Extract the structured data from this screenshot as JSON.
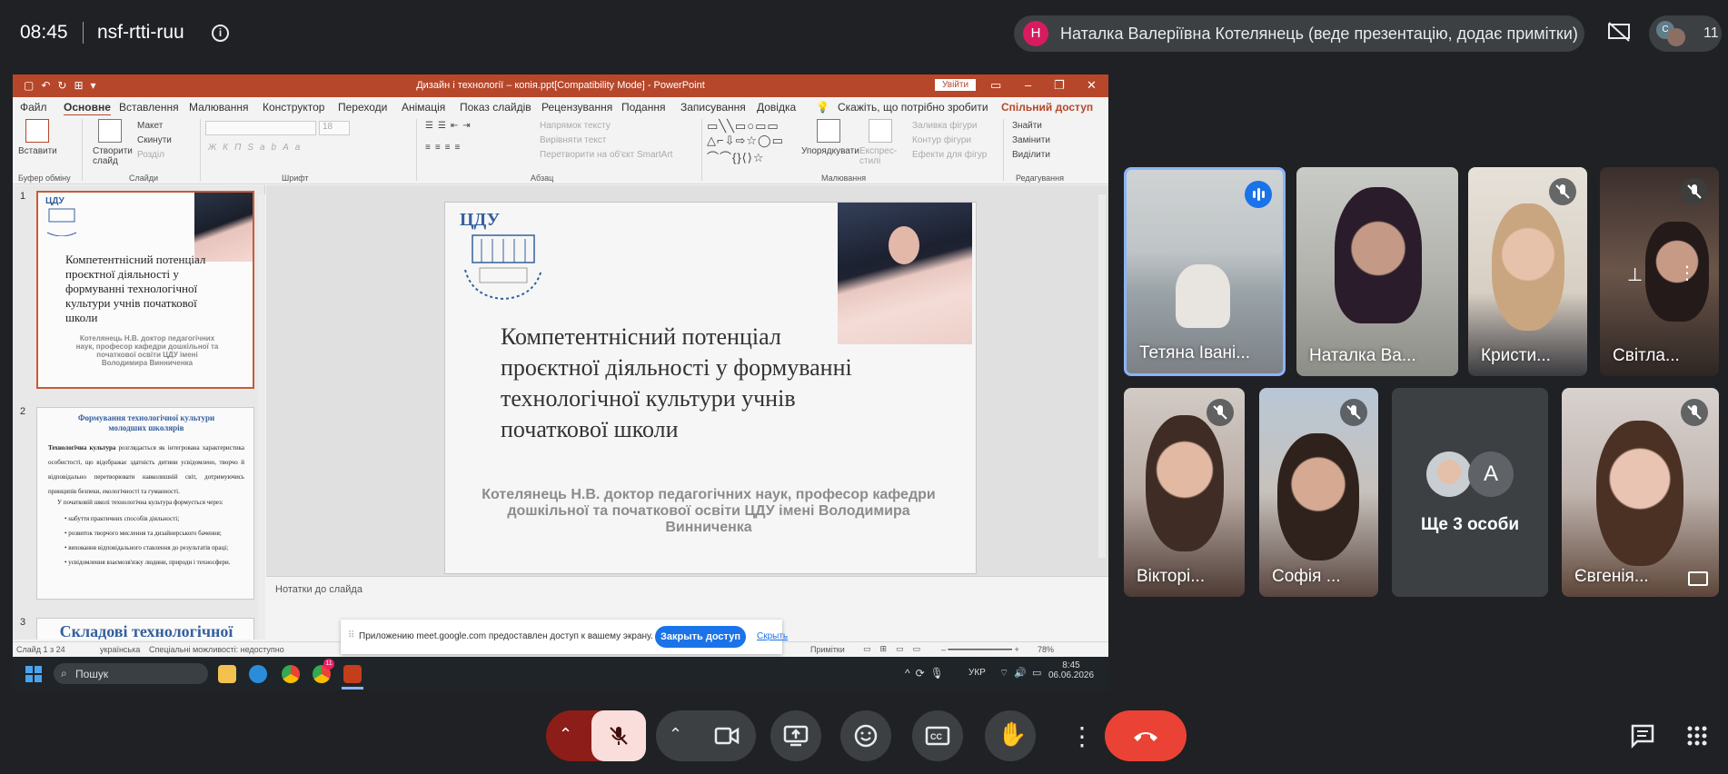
{
  "topbar": {
    "time": "08:45",
    "meeting_code": "nsf-rtti-ruu",
    "presenter_initial": "Н",
    "presenter_label": "Наталка Валеріївна Котелянець (веде презентацію, додає примітки)",
    "participant_count": "11",
    "avatar_initial": "С"
  },
  "powerpoint": {
    "window_title": "Дизайн і технології – копія.ppt[Compatibility Mode] - PowerPoint",
    "sign_in": "Увійти",
    "menu": [
      "Файл",
      "Основне",
      "Вставлення",
      "Малювання",
      "Конструктор",
      "Переходи",
      "Анімація",
      "Показ слайдів",
      "Рецензування",
      "Подання",
      "Записування",
      "Довідка"
    ],
    "tell_me": "Скажіть, що потрібно зробити",
    "share": "Спільний доступ",
    "ribbon": {
      "paste": "Вставити",
      "clipboard_group": "Буфер обміну",
      "new_slide": "Створити слайд",
      "layout": "Макет",
      "reset": "Скинути",
      "section": "Розділ",
      "slides_group": "Слайди",
      "font_group": "Шрифт",
      "font_size": "18",
      "text_direction": "Напрямок тексту",
      "align_text": "Вирівняти текст",
      "convert_smartart": "Перетворити на об'єкт SmartArt",
      "paragraph_group": "Абзац",
      "arrange": "Упорядкувати",
      "quick_styles": "Експрес-стилі",
      "shape_fill": "Заливка фігури",
      "shape_outline": "Контур фігури",
      "shape_effects": "Ефекти для фігур",
      "drawing_group": "Малювання",
      "find": "Знайти",
      "replace": "Замінити",
      "select": "Виділити",
      "editing_group": "Редагування"
    },
    "thumbnails": {
      "n1": "1",
      "n2": "2",
      "n3": "3",
      "t1_title": "Компетентнісний потенціал проєктної діяльності у формуванні технологічної культури учнів початкової школи",
      "t1_sub": "Котелянець Н.В. доктор педагогічних наук, професор кафедри дошкільної та початкової освіти ЦДУ імені Володимира Винниченка",
      "t1_logo": "ЦДУ",
      "t2_title": "Формування технологічної культури молодших школярів",
      "t2_p1_bold": "Технологічна культура",
      "t2_p1": " розглядається як інтегрована характеристика особистості, що відображає здатність дитини усвідомлено, творчо й відповідально перетворювати навколишній світ, дотримуючись принципів безпеки, екологічності та гуманності.",
      "t2_p2": "У початковій школі технологічна культура формується через:",
      "t2_bullets": [
        "набуття практичних способів діяльності;",
        "розвиток творчого мислення та дизайнерського бачення;",
        "виховання відповідального ставлення до результатів праці;",
        "усвідомлення взаємозв'язку людини, природи і техносфери."
      ],
      "t3_title": "Складові технологічної"
    },
    "slide": {
      "logo": "ЦДУ",
      "title_lines": [
        "Компетентнісний потенціал",
        "проєктної діяльності у формуванні",
        "технологічної культури учнів",
        "початкової школи"
      ],
      "subtitle": "Котелянець Н.В. доктор педагогічних наук, професор кафедри дошкільної та початкової освіти ЦДУ імені Володимира Винниченка"
    },
    "notes_placeholder": "Нотатки до слайда",
    "status": {
      "slide_count": "Слайд 1 з 24",
      "language": "українська",
      "accessibility": "Спеціальні можливості: недоступно",
      "notes": "Примітки",
      "zoom": "78%"
    }
  },
  "screen_share_bar": {
    "message": "Приложению meet.google.com предоставлен доступ к вашему экрану.",
    "stop": "Закрыть доступ",
    "hide": "Скрыть"
  },
  "windows_taskbar": {
    "search": "Пошук",
    "lang": "УКР",
    "time": "8:45",
    "date": "06.06.2026",
    "badge": "11"
  },
  "participants": {
    "tiles": [
      {
        "name": "Тетяна Івані..."
      },
      {
        "name": "Наталка Ва..."
      },
      {
        "name": "Кристи..."
      },
      {
        "name": "Світла..."
      },
      {
        "name": "Вікторі..."
      },
      {
        "name": "Софія ..."
      },
      {
        "name": "Ще 3 особи"
      },
      {
        "name": "Євгенія..."
      }
    ],
    "more_avatar_letter": "А"
  }
}
